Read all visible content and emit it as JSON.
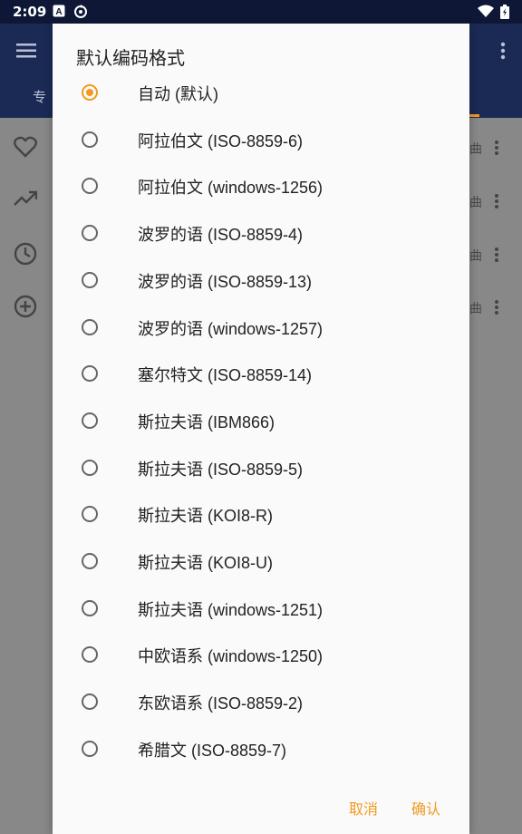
{
  "status_bar": {
    "time": "2:09",
    "left_icons": [
      "a-icon",
      "sync-icon"
    ],
    "right_icons": [
      "wifi-icon",
      "battery-icon"
    ]
  },
  "app_bar": {
    "tab_left_fragment": "专",
    "tab_right_fragment": "",
    "accent_color": "#f29a1f",
    "primary_color": "#1a2a55"
  },
  "background_rows": [
    {
      "icon": "heart-icon",
      "right_text": "曲"
    },
    {
      "icon": "trending-up-icon",
      "right_text": "曲"
    },
    {
      "icon": "clock-icon",
      "right_text": "曲"
    },
    {
      "icon": "add-circle-icon",
      "right_text": "曲"
    }
  ],
  "dialog": {
    "title": "默认编码格式",
    "options": [
      {
        "label": "自动 (默认)",
        "selected": true
      },
      {
        "label": "阿拉伯文 (ISO-8859-6)",
        "selected": false
      },
      {
        "label": "阿拉伯文 (windows-1256)",
        "selected": false
      },
      {
        "label": "波罗的语 (ISO-8859-4)",
        "selected": false
      },
      {
        "label": "波罗的语 (ISO-8859-13)",
        "selected": false
      },
      {
        "label": "波罗的语 (windows-1257)",
        "selected": false
      },
      {
        "label": "塞尔特文 (ISO-8859-14)",
        "selected": false
      },
      {
        "label": "斯拉夫语 (IBM866)",
        "selected": false
      },
      {
        "label": "斯拉夫语 (ISO-8859-5)",
        "selected": false
      },
      {
        "label": "斯拉夫语 (KOI8-R)",
        "selected": false
      },
      {
        "label": "斯拉夫语 (KOI8-U)",
        "selected": false
      },
      {
        "label": "斯拉夫语 (windows-1251)",
        "selected": false
      },
      {
        "label": "中欧语系 (windows-1250)",
        "selected": false
      },
      {
        "label": "东欧语系 (ISO-8859-2)",
        "selected": false
      },
      {
        "label": "希腊文 (ISO-8859-7)",
        "selected": false
      }
    ],
    "cancel_label": "取消",
    "confirm_label": "确认"
  }
}
